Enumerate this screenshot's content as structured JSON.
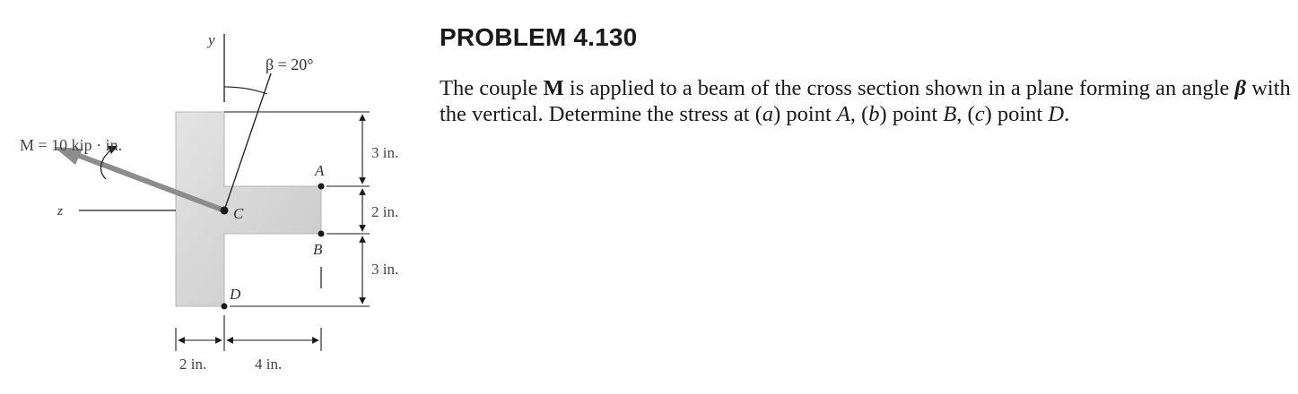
{
  "problem": {
    "title": "PROBLEM 4.130",
    "text_parts": {
      "p1": "The couple ",
      "M": "M",
      "p2": " is applied to a beam of the cross section shown in a plane forming an angle ",
      "beta": "β",
      "p3": " with the vertical. Determine the stress at (",
      "a": "a",
      "p4": ") point ",
      "A": "A",
      "p5": ", (",
      "b": "b",
      "p6": ") point ",
      "B": "B",
      "p7": ", (",
      "c": "c",
      "p8": ") point ",
      "D": "D",
      "p9": "."
    }
  },
  "figure": {
    "axis_y": "y",
    "axis_z": "z",
    "angle_label": "β = 20°",
    "moment_label": "M = 10 kip · in.",
    "point_A": "A",
    "point_B": "B",
    "point_C": "C",
    "point_D": "D",
    "dim_top": "3 in.",
    "dim_mid": "2 in.",
    "dim_bot": "3 in.",
    "dim_left": "2 in.",
    "dim_right": "4 in.",
    "colors": {
      "section_fill": "#d3d3d3",
      "arrow": "#8c8c8c",
      "line": "#1a1a1a"
    }
  }
}
